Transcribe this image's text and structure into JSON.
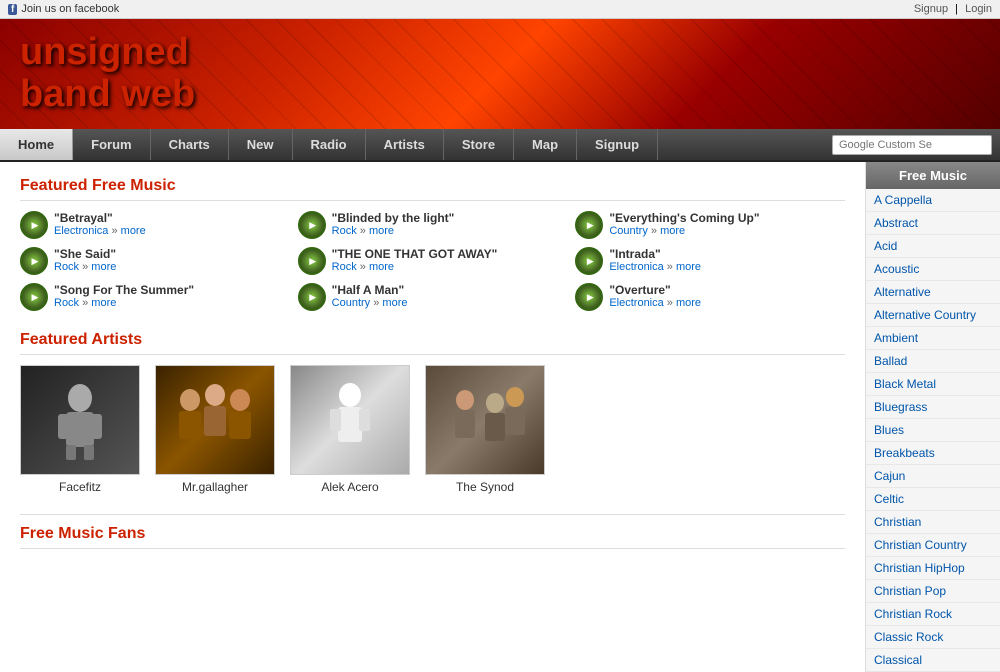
{
  "topbar": {
    "facebook_text": "Join us on facebook",
    "signup_label": "Signup",
    "login_label": "Login",
    "separator": "|"
  },
  "logo": {
    "line1": "unsigned",
    "line2": "band web"
  },
  "nav": {
    "items": [
      {
        "label": "Home",
        "active": true
      },
      {
        "label": "Forum",
        "active": false
      },
      {
        "label": "Charts",
        "active": false
      },
      {
        "label": "New",
        "active": false
      },
      {
        "label": "Radio",
        "active": false
      },
      {
        "label": "Artists",
        "active": false
      },
      {
        "label": "Store",
        "active": false
      },
      {
        "label": "Map",
        "active": false
      },
      {
        "label": "Signup",
        "active": false
      }
    ],
    "search_placeholder": "Google Custom Se"
  },
  "featured_music": {
    "section_title": "Featured Free Music",
    "songs": [
      {
        "title": "\"Betrayal\"",
        "genre": "Electronica",
        "more_label": "more"
      },
      {
        "title": "\"Blinded by the light\"",
        "genre": "Rock",
        "more_label": "more"
      },
      {
        "title": "\"Everything's Coming Up\"",
        "genre": "Country",
        "more_label": "more"
      },
      {
        "title": "\"She Said\"",
        "genre": "Rock",
        "more_label": "more"
      },
      {
        "title": "\"THE ONE THAT GOT AWAY\"",
        "genre": "Rock",
        "more_label": "more"
      },
      {
        "title": "\"Intrada\"",
        "genre": "Electronica",
        "more_label": "more"
      },
      {
        "title": "\"Song For The Summer\"",
        "genre": "Rock",
        "more_label": "more"
      },
      {
        "title": "\"Half A Man\"",
        "genre": "Country",
        "more_label": "more"
      },
      {
        "title": "\"Overture\"",
        "genre": "Electronica",
        "more_label": "more"
      }
    ]
  },
  "featured_artists": {
    "section_title": "Featured Artists",
    "artists": [
      {
        "name": "Facefitz",
        "style": "dark"
      },
      {
        "name": "Mr.gallagher",
        "style": "group"
      },
      {
        "name": "Alek Acero",
        "style": "white"
      },
      {
        "name": "The Synod",
        "style": "studio"
      }
    ]
  },
  "fans_section": {
    "section_title": "Free Music Fans"
  },
  "sidebar": {
    "title": "Free Music",
    "categories": [
      "A Cappella",
      "Abstract",
      "Acid",
      "Acoustic",
      "Alternative",
      "Alternative Country",
      "Ambient",
      "Ballad",
      "Black Metal",
      "Bluegrass",
      "Blues",
      "Breakbeats",
      "Cajun",
      "Celtic",
      "Christian",
      "Christian Country",
      "Christian HipHop",
      "Christian Pop",
      "Christian Rock",
      "Classic Rock",
      "Classical"
    ]
  }
}
